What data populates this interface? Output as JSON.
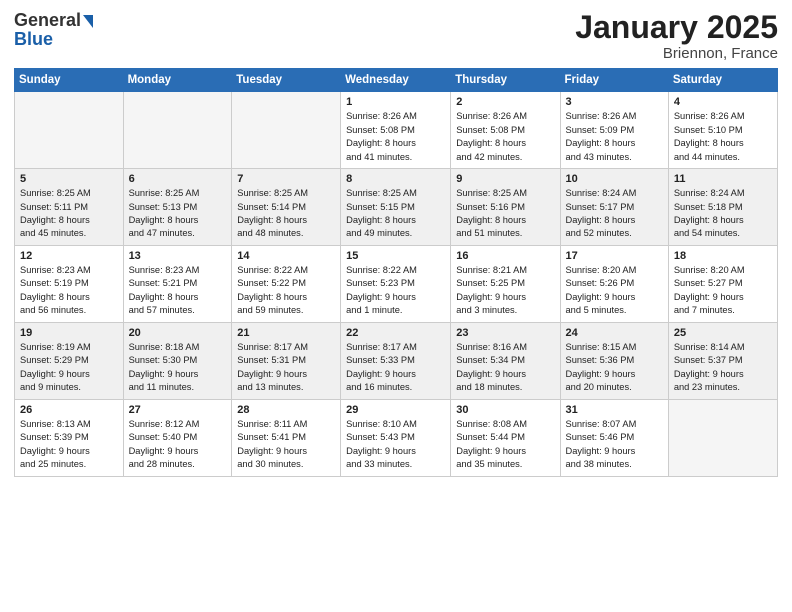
{
  "logo": {
    "general": "General",
    "blue": "Blue"
  },
  "header": {
    "month": "January 2025",
    "location": "Briennon, France"
  },
  "weekdays": [
    "Sunday",
    "Monday",
    "Tuesday",
    "Wednesday",
    "Thursday",
    "Friday",
    "Saturday"
  ],
  "weeks": [
    [
      {
        "day": "",
        "info": ""
      },
      {
        "day": "",
        "info": ""
      },
      {
        "day": "",
        "info": ""
      },
      {
        "day": "1",
        "info": "Sunrise: 8:26 AM\nSunset: 5:08 PM\nDaylight: 8 hours\nand 41 minutes."
      },
      {
        "day": "2",
        "info": "Sunrise: 8:26 AM\nSunset: 5:08 PM\nDaylight: 8 hours\nand 42 minutes."
      },
      {
        "day": "3",
        "info": "Sunrise: 8:26 AM\nSunset: 5:09 PM\nDaylight: 8 hours\nand 43 minutes."
      },
      {
        "day": "4",
        "info": "Sunrise: 8:26 AM\nSunset: 5:10 PM\nDaylight: 8 hours\nand 44 minutes."
      }
    ],
    [
      {
        "day": "5",
        "info": "Sunrise: 8:25 AM\nSunset: 5:11 PM\nDaylight: 8 hours\nand 45 minutes."
      },
      {
        "day": "6",
        "info": "Sunrise: 8:25 AM\nSunset: 5:13 PM\nDaylight: 8 hours\nand 47 minutes."
      },
      {
        "day": "7",
        "info": "Sunrise: 8:25 AM\nSunset: 5:14 PM\nDaylight: 8 hours\nand 48 minutes."
      },
      {
        "day": "8",
        "info": "Sunrise: 8:25 AM\nSunset: 5:15 PM\nDaylight: 8 hours\nand 49 minutes."
      },
      {
        "day": "9",
        "info": "Sunrise: 8:25 AM\nSunset: 5:16 PM\nDaylight: 8 hours\nand 51 minutes."
      },
      {
        "day": "10",
        "info": "Sunrise: 8:24 AM\nSunset: 5:17 PM\nDaylight: 8 hours\nand 52 minutes."
      },
      {
        "day": "11",
        "info": "Sunrise: 8:24 AM\nSunset: 5:18 PM\nDaylight: 8 hours\nand 54 minutes."
      }
    ],
    [
      {
        "day": "12",
        "info": "Sunrise: 8:23 AM\nSunset: 5:19 PM\nDaylight: 8 hours\nand 56 minutes."
      },
      {
        "day": "13",
        "info": "Sunrise: 8:23 AM\nSunset: 5:21 PM\nDaylight: 8 hours\nand 57 minutes."
      },
      {
        "day": "14",
        "info": "Sunrise: 8:22 AM\nSunset: 5:22 PM\nDaylight: 8 hours\nand 59 minutes."
      },
      {
        "day": "15",
        "info": "Sunrise: 8:22 AM\nSunset: 5:23 PM\nDaylight: 9 hours\nand 1 minute."
      },
      {
        "day": "16",
        "info": "Sunrise: 8:21 AM\nSunset: 5:25 PM\nDaylight: 9 hours\nand 3 minutes."
      },
      {
        "day": "17",
        "info": "Sunrise: 8:20 AM\nSunset: 5:26 PM\nDaylight: 9 hours\nand 5 minutes."
      },
      {
        "day": "18",
        "info": "Sunrise: 8:20 AM\nSunset: 5:27 PM\nDaylight: 9 hours\nand 7 minutes."
      }
    ],
    [
      {
        "day": "19",
        "info": "Sunrise: 8:19 AM\nSunset: 5:29 PM\nDaylight: 9 hours\nand 9 minutes."
      },
      {
        "day": "20",
        "info": "Sunrise: 8:18 AM\nSunset: 5:30 PM\nDaylight: 9 hours\nand 11 minutes."
      },
      {
        "day": "21",
        "info": "Sunrise: 8:17 AM\nSunset: 5:31 PM\nDaylight: 9 hours\nand 13 minutes."
      },
      {
        "day": "22",
        "info": "Sunrise: 8:17 AM\nSunset: 5:33 PM\nDaylight: 9 hours\nand 16 minutes."
      },
      {
        "day": "23",
        "info": "Sunrise: 8:16 AM\nSunset: 5:34 PM\nDaylight: 9 hours\nand 18 minutes."
      },
      {
        "day": "24",
        "info": "Sunrise: 8:15 AM\nSunset: 5:36 PM\nDaylight: 9 hours\nand 20 minutes."
      },
      {
        "day": "25",
        "info": "Sunrise: 8:14 AM\nSunset: 5:37 PM\nDaylight: 9 hours\nand 23 minutes."
      }
    ],
    [
      {
        "day": "26",
        "info": "Sunrise: 8:13 AM\nSunset: 5:39 PM\nDaylight: 9 hours\nand 25 minutes."
      },
      {
        "day": "27",
        "info": "Sunrise: 8:12 AM\nSunset: 5:40 PM\nDaylight: 9 hours\nand 28 minutes."
      },
      {
        "day": "28",
        "info": "Sunrise: 8:11 AM\nSunset: 5:41 PM\nDaylight: 9 hours\nand 30 minutes."
      },
      {
        "day": "29",
        "info": "Sunrise: 8:10 AM\nSunset: 5:43 PM\nDaylight: 9 hours\nand 33 minutes."
      },
      {
        "day": "30",
        "info": "Sunrise: 8:08 AM\nSunset: 5:44 PM\nDaylight: 9 hours\nand 35 minutes."
      },
      {
        "day": "31",
        "info": "Sunrise: 8:07 AM\nSunset: 5:46 PM\nDaylight: 9 hours\nand 38 minutes."
      },
      {
        "day": "",
        "info": ""
      }
    ]
  ]
}
